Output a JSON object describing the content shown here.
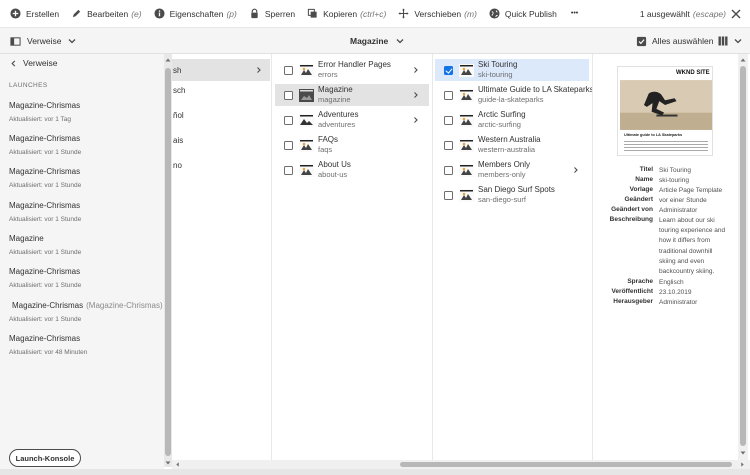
{
  "actionbar": {
    "create": "Erstellen",
    "edit": "Bearbeiten",
    "edit_shortcut": "(e)",
    "properties": "Eigenschaften",
    "properties_shortcut": "(p)",
    "lock": "Sperren",
    "copy": "Kopieren",
    "copy_shortcut": "(ctrl+c)",
    "move": "Verschieben",
    "move_shortcut": "(m)",
    "quick_publish": "Quick Publish",
    "more": "•••",
    "selected": "1 ausgewählt",
    "selected_shortcut": "(escape)"
  },
  "header": {
    "rail_label": "Verweise",
    "title": "Magazine",
    "select_all": "Alles auswählen"
  },
  "rail": {
    "back_label": "Verweise",
    "section": "LAUNCHES",
    "launches": [
      {
        "title": "Magazine-Chrismas",
        "sub": "Aktualisiert: vor 1 Tag"
      },
      {
        "title": "Magazine-Chrismas",
        "sub": "Aktualisiert: vor 1 Stunde"
      },
      {
        "title": "Magazine-Chrismas",
        "sub": "Aktualisiert: vor 1 Stunde"
      },
      {
        "title": "Magazine-Chrismas",
        "sub": "Aktualisiert: vor 1 Stunde"
      },
      {
        "title": "Magazine",
        "sub": "Aktualisiert: vor 1 Stunde"
      },
      {
        "title": "Magazine-Chrismas",
        "sub": "Aktualisiert: vor 1 Stunde"
      },
      {
        "title": "Magazine-Chrismas",
        "alt": "(Magazine-Chrismas)",
        "sub": "Aktualisiert: vor 1 Stunde"
      },
      {
        "title": "Magazine-Chrismas",
        "sub": "Aktualisiert: vor 48 Minuten"
      }
    ],
    "console_button": "Launch-Konsole"
  },
  "column1": {
    "items": [
      "sh",
      "sch",
      "ñol",
      "ais",
      "no"
    ]
  },
  "column2": {
    "items": [
      {
        "name": "Error Handler Pages",
        "url": "errors"
      },
      {
        "name": "Magazine",
        "url": "magazine"
      },
      {
        "name": "Adventures",
        "url": "adventures"
      },
      {
        "name": "FAQs",
        "url": "faqs"
      },
      {
        "name": "About Us",
        "url": "about-us"
      }
    ]
  },
  "column3": {
    "items": [
      {
        "name": "Ski Touring",
        "url": "ski-touring"
      },
      {
        "name": "Ultimate Guide to LA Skateparks",
        "url": "guide-la-skateparks"
      },
      {
        "name": "Arctic Surfing",
        "url": "arctic-surfing"
      },
      {
        "name": "Western Australia",
        "url": "western-australia"
      },
      {
        "name": "Members Only",
        "url": "members-only"
      },
      {
        "name": "San Diego Surf Spots",
        "url": "san-diego-surf"
      }
    ]
  },
  "preview": {
    "thumb_site": "WKND SITE",
    "thumb_heading": "Ultimate guide to LA Skateparks",
    "meta": [
      {
        "k": "Titel",
        "v": "Ski Touring"
      },
      {
        "k": "Name",
        "v": "ski-touring"
      },
      {
        "k": "Vorlage",
        "v": "Article Page Template"
      },
      {
        "k": "Geändert",
        "v": "vor einer Stunde"
      },
      {
        "k": "Geändert von",
        "v": "Administrator"
      },
      {
        "k": "Beschreibung",
        "v": "Learn about our ski touring experience and how it differs from traditional downhill skiing and even backcountry skiing."
      },
      {
        "k": "Sprache",
        "v": "Englisch"
      },
      {
        "k": "Veröffentlicht",
        "v": "23.10.2019"
      },
      {
        "k": "Herausgeber",
        "v": "Administrator"
      }
    ]
  },
  "colors": {
    "accent": "#1473e6",
    "selected_row": "#e3e3e3",
    "checked_row": "#dbe9fb",
    "rail_bg": "#f5f5f5"
  }
}
